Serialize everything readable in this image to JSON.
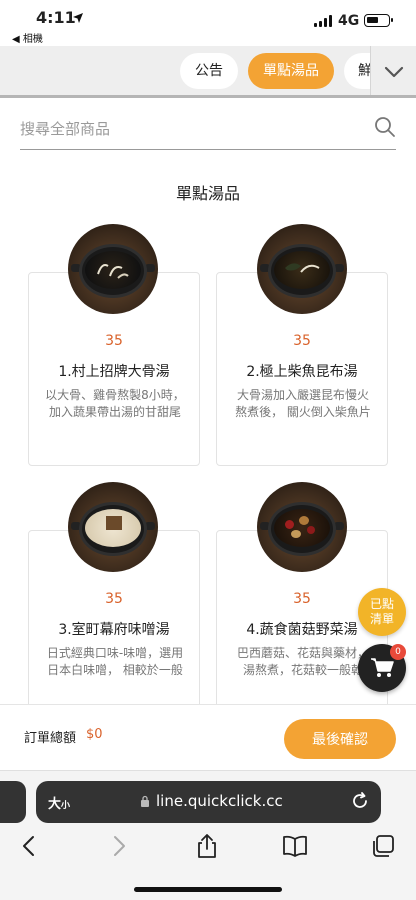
{
  "status_bar": {
    "time": "4:11",
    "back_app": "◀ 相機",
    "network": "4G"
  },
  "tabs": [
    {
      "label": "公告",
      "active": false
    },
    {
      "label": "單點湯品",
      "active": true
    },
    {
      "label": "鮮",
      "active": false
    }
  ],
  "search": {
    "placeholder": "搜尋全部商品",
    "value": ""
  },
  "section_title": "單點湯品",
  "products": [
    {
      "price": "35",
      "name": "1.村上招牌大骨湯",
      "desc_line1": "以大骨、雞骨熬製8小時，",
      "desc_line2": "加入蔬果帶出湯的甘甜尾"
    },
    {
      "price": "35",
      "name": "2.極上柴魚昆布湯",
      "desc_line1": "大骨湯加入嚴選昆布慢火",
      "desc_line2": "熬煮後， 關火倒入柴魚片"
    },
    {
      "price": "35",
      "name": "3.室町幕府味噌湯",
      "desc_line1": "日式經典口味-味噌，選用",
      "desc_line2": "日本白味噌， 相較於一般"
    },
    {
      "price": "35",
      "name": "4.蔬食菌菇野菜湯",
      "desc_line1": "巴西蘑菇、花菇與藥材，",
      "desc_line2": "湯熬煮，花菇較一般乾"
    }
  ],
  "floating": {
    "added_line1": "已點",
    "added_line2": "清單",
    "cart_count": "0"
  },
  "order": {
    "total_label": "訂單總額",
    "total_amount": "$0",
    "confirm_label": "最後確認"
  },
  "browser": {
    "text_size_label": "大",
    "text_size_small": "小",
    "url": "line.quickclick.cc"
  }
}
